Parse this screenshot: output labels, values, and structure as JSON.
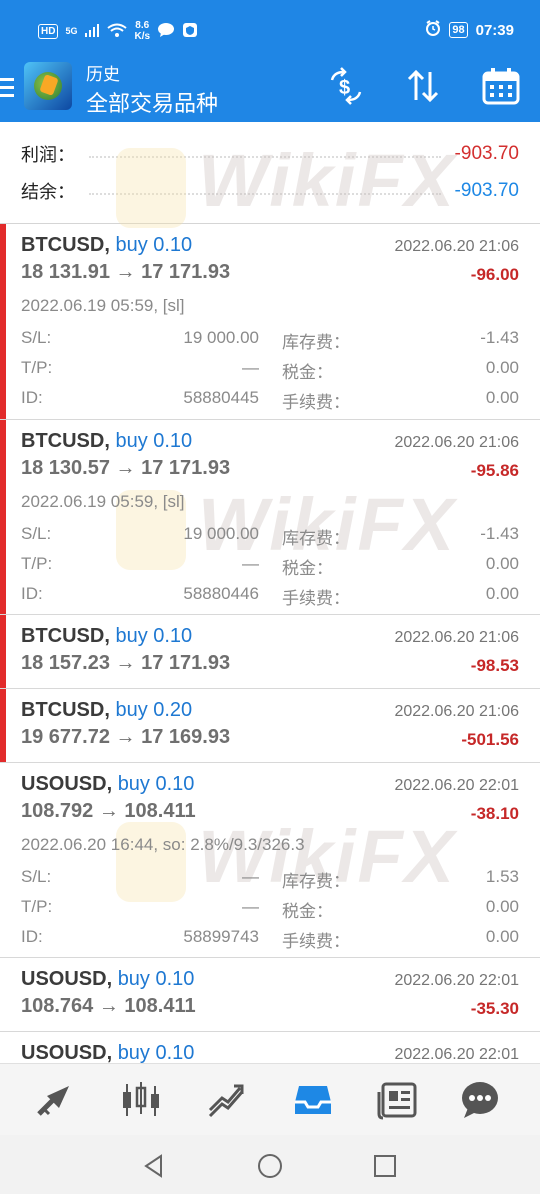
{
  "status_bar": {
    "network": "HD",
    "signal": "5G",
    "speed_value": "8.6",
    "speed_unit": "K/s",
    "battery": "98",
    "time": "07:39"
  },
  "header": {
    "title": "历史",
    "subtitle": "全部交易品种",
    "icons": [
      "menu-icon",
      "currency-exchange-icon",
      "sort-icon",
      "calendar-icon"
    ]
  },
  "summary": {
    "profit_label": "利润：",
    "profit_value": "-903.70",
    "balance_label": "结余：",
    "balance_value": "-903.70"
  },
  "labels": {
    "sl": "S/L:",
    "tp": "T/P:",
    "id": "ID:",
    "swap": "库存费：",
    "tax": "税金：",
    "fee": "手续费："
  },
  "trades": [
    {
      "symbol": "BTCUSD,",
      "side": "buy 0.10",
      "close_time": "2022.06.20 21:06",
      "price": "18 131.91 → 17 171.93",
      "profit": "-96.00",
      "open": "2022.06.19 05:59, [sl]",
      "sl": "19 000.00",
      "tp": "—",
      "id": "58880445",
      "swap": "-1.43",
      "tax": "0.00",
      "fee": "0.00"
    },
    {
      "symbol": "BTCUSD,",
      "side": "buy 0.10",
      "close_time": "2022.06.20 21:06",
      "price": "18 130.57 → 17 171.93",
      "profit": "-95.86",
      "open": "2022.06.19 05:59, [sl]",
      "sl": "19 000.00",
      "tp": "—",
      "id": "58880446",
      "swap": "-1.43",
      "tax": "0.00",
      "fee": "0.00"
    },
    {
      "symbol": "BTCUSD,",
      "side": "buy 0.10",
      "close_time": "2022.06.20 21:06",
      "price": "18 157.23 → 17 171.93",
      "profit": "-98.53"
    },
    {
      "symbol": "BTCUSD,",
      "side": "buy 0.20",
      "close_time": "2022.06.20 21:06",
      "price": "19 677.72 → 17 169.93",
      "profit": "-501.56"
    },
    {
      "symbol": "USOUSD,",
      "side": "buy 0.10",
      "close_time": "2022.06.20 22:01",
      "price": "108.792 → 108.411",
      "profit": "-38.10",
      "open": "2022.06.20 16:44, so: 2.8%/9.3/326.3",
      "sl": "—",
      "tp": "—",
      "id": "58899743",
      "swap": "1.53",
      "tax": "0.00",
      "fee": "0.00"
    },
    {
      "symbol": "USOUSD,",
      "side": "buy 0.10",
      "close_time": "2022.06.20 22:01",
      "price": "108.764 → 108.411",
      "profit": "-35.30"
    },
    {
      "symbol": "USOUSD,",
      "side": "buy 0.10",
      "close_time": "2022.06.20 22:01"
    }
  ],
  "watermark": "WikiFX",
  "bottom_nav": [
    "quotes-icon",
    "chart-candles-icon",
    "trade-icon",
    "history-icon",
    "news-icon",
    "chat-icon"
  ],
  "colors": {
    "header_blue": "#1f86e5",
    "loss_red": "#c62828",
    "buy_blue": "#1e78d2",
    "sell_bar_red": "#e22b2b",
    "active_nav": "#1e88e5"
  }
}
